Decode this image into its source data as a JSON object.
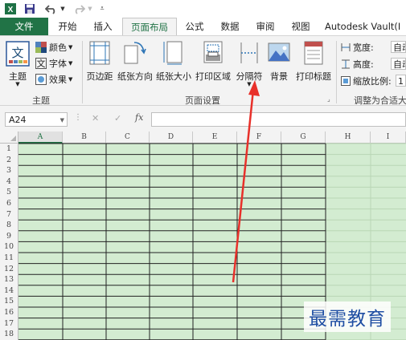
{
  "quick_access": {
    "app_icon": "excel-icon",
    "save_icon": "save-icon",
    "undo_icon": "undo-icon",
    "redo_icon": "redo-icon",
    "customize_icon": "customize-qat-icon"
  },
  "tabs": [
    "文件",
    "开始",
    "插入",
    "页面布局",
    "公式",
    "数据",
    "审阅",
    "视图",
    "Autodesk Vault(I"
  ],
  "active_tab": "页面布局",
  "ribbon": {
    "themes_group": {
      "label": "主题",
      "theme_button": "主题",
      "colors": "颜色",
      "fonts": "字体",
      "effects": "效果",
      "theme_glyph": "文"
    },
    "page_setup_group": {
      "label": "页面设置",
      "margins": "页边距",
      "orientation": "纸张方向",
      "size": "纸张大小",
      "print_area": "打印区域",
      "breaks": "分隔符",
      "background": "背景",
      "print_titles": "打印标题"
    },
    "scale_group": {
      "label": "调整为合适大",
      "width_label": "宽度:",
      "width_value": "自动",
      "height_label": "高度:",
      "height_value": "自动",
      "scale_label": "缩放比例:",
      "scale_value": "1"
    }
  },
  "formula_bar": {
    "name_box": "A24",
    "cancel": "✕",
    "enter": "✓",
    "fx": "fx",
    "value": ""
  },
  "sheet": {
    "columns": [
      "A",
      "B",
      "C",
      "D",
      "E",
      "F",
      "G",
      "H",
      "I"
    ],
    "selected_column": "A",
    "rows": [
      "1",
      "2",
      "3",
      "4",
      "5",
      "6",
      "7",
      "8",
      "9",
      "10",
      "11",
      "12",
      "13",
      "14",
      "15",
      "16",
      "17",
      "18"
    ]
  },
  "colors": {
    "excel_green": "#217346",
    "cell_fill": "#d3ecd1",
    "annotation_arrow": "#e8302a"
  },
  "watermark": "最需教育"
}
